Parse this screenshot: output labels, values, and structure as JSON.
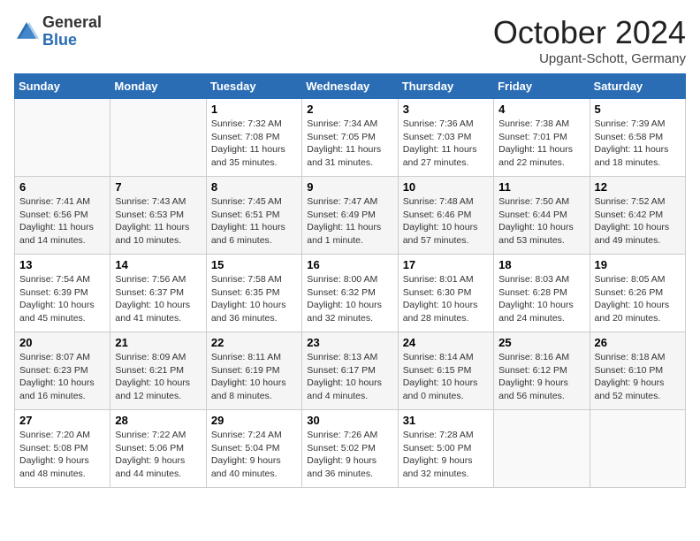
{
  "logo": {
    "general": "General",
    "blue": "Blue"
  },
  "title": "October 2024",
  "location": "Upgant-Schott, Germany",
  "weekdays": [
    "Sunday",
    "Monday",
    "Tuesday",
    "Wednesday",
    "Thursday",
    "Friday",
    "Saturday"
  ],
  "weeks": [
    [
      {
        "day": "",
        "info": ""
      },
      {
        "day": "",
        "info": ""
      },
      {
        "day": "1",
        "info": "Sunrise: 7:32 AM\nSunset: 7:08 PM\nDaylight: 11 hours and 35 minutes."
      },
      {
        "day": "2",
        "info": "Sunrise: 7:34 AM\nSunset: 7:05 PM\nDaylight: 11 hours and 31 minutes."
      },
      {
        "day": "3",
        "info": "Sunrise: 7:36 AM\nSunset: 7:03 PM\nDaylight: 11 hours and 27 minutes."
      },
      {
        "day": "4",
        "info": "Sunrise: 7:38 AM\nSunset: 7:01 PM\nDaylight: 11 hours and 22 minutes."
      },
      {
        "day": "5",
        "info": "Sunrise: 7:39 AM\nSunset: 6:58 PM\nDaylight: 11 hours and 18 minutes."
      }
    ],
    [
      {
        "day": "6",
        "info": "Sunrise: 7:41 AM\nSunset: 6:56 PM\nDaylight: 11 hours and 14 minutes."
      },
      {
        "day": "7",
        "info": "Sunrise: 7:43 AM\nSunset: 6:53 PM\nDaylight: 11 hours and 10 minutes."
      },
      {
        "day": "8",
        "info": "Sunrise: 7:45 AM\nSunset: 6:51 PM\nDaylight: 11 hours and 6 minutes."
      },
      {
        "day": "9",
        "info": "Sunrise: 7:47 AM\nSunset: 6:49 PM\nDaylight: 11 hours and 1 minute."
      },
      {
        "day": "10",
        "info": "Sunrise: 7:48 AM\nSunset: 6:46 PM\nDaylight: 10 hours and 57 minutes."
      },
      {
        "day": "11",
        "info": "Sunrise: 7:50 AM\nSunset: 6:44 PM\nDaylight: 10 hours and 53 minutes."
      },
      {
        "day": "12",
        "info": "Sunrise: 7:52 AM\nSunset: 6:42 PM\nDaylight: 10 hours and 49 minutes."
      }
    ],
    [
      {
        "day": "13",
        "info": "Sunrise: 7:54 AM\nSunset: 6:39 PM\nDaylight: 10 hours and 45 minutes."
      },
      {
        "day": "14",
        "info": "Sunrise: 7:56 AM\nSunset: 6:37 PM\nDaylight: 10 hours and 41 minutes."
      },
      {
        "day": "15",
        "info": "Sunrise: 7:58 AM\nSunset: 6:35 PM\nDaylight: 10 hours and 36 minutes."
      },
      {
        "day": "16",
        "info": "Sunrise: 8:00 AM\nSunset: 6:32 PM\nDaylight: 10 hours and 32 minutes."
      },
      {
        "day": "17",
        "info": "Sunrise: 8:01 AM\nSunset: 6:30 PM\nDaylight: 10 hours and 28 minutes."
      },
      {
        "day": "18",
        "info": "Sunrise: 8:03 AM\nSunset: 6:28 PM\nDaylight: 10 hours and 24 minutes."
      },
      {
        "day": "19",
        "info": "Sunrise: 8:05 AM\nSunset: 6:26 PM\nDaylight: 10 hours and 20 minutes."
      }
    ],
    [
      {
        "day": "20",
        "info": "Sunrise: 8:07 AM\nSunset: 6:23 PM\nDaylight: 10 hours and 16 minutes."
      },
      {
        "day": "21",
        "info": "Sunrise: 8:09 AM\nSunset: 6:21 PM\nDaylight: 10 hours and 12 minutes."
      },
      {
        "day": "22",
        "info": "Sunrise: 8:11 AM\nSunset: 6:19 PM\nDaylight: 10 hours and 8 minutes."
      },
      {
        "day": "23",
        "info": "Sunrise: 8:13 AM\nSunset: 6:17 PM\nDaylight: 10 hours and 4 minutes."
      },
      {
        "day": "24",
        "info": "Sunrise: 8:14 AM\nSunset: 6:15 PM\nDaylight: 10 hours and 0 minutes."
      },
      {
        "day": "25",
        "info": "Sunrise: 8:16 AM\nSunset: 6:12 PM\nDaylight: 9 hours and 56 minutes."
      },
      {
        "day": "26",
        "info": "Sunrise: 8:18 AM\nSunset: 6:10 PM\nDaylight: 9 hours and 52 minutes."
      }
    ],
    [
      {
        "day": "27",
        "info": "Sunrise: 7:20 AM\nSunset: 5:08 PM\nDaylight: 9 hours and 48 minutes."
      },
      {
        "day": "28",
        "info": "Sunrise: 7:22 AM\nSunset: 5:06 PM\nDaylight: 9 hours and 44 minutes."
      },
      {
        "day": "29",
        "info": "Sunrise: 7:24 AM\nSunset: 5:04 PM\nDaylight: 9 hours and 40 minutes."
      },
      {
        "day": "30",
        "info": "Sunrise: 7:26 AM\nSunset: 5:02 PM\nDaylight: 9 hours and 36 minutes."
      },
      {
        "day": "31",
        "info": "Sunrise: 7:28 AM\nSunset: 5:00 PM\nDaylight: 9 hours and 32 minutes."
      },
      {
        "day": "",
        "info": ""
      },
      {
        "day": "",
        "info": ""
      }
    ]
  ]
}
